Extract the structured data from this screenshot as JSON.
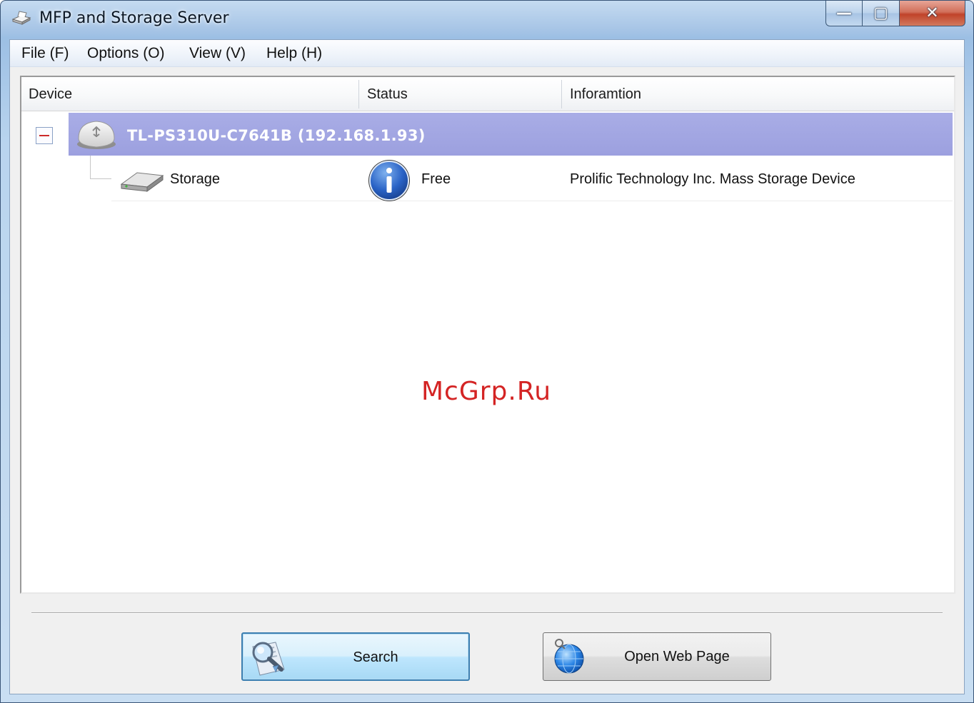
{
  "window": {
    "title": "MFP and Storage Server",
    "caption_buttons": {
      "minimize": "—",
      "maximize": "▢",
      "close": "✕"
    }
  },
  "menu": {
    "items": [
      {
        "label": "File (F)"
      },
      {
        "label": "Options (O)"
      },
      {
        "label": "View (V)"
      },
      {
        "label": "Help (H)"
      }
    ]
  },
  "list": {
    "columns": [
      "Device",
      "Status",
      "Inforamtion"
    ],
    "device": {
      "name": "TL-PS310U-C7641B  (192.168.1.93)",
      "expanded": true,
      "icon": "usb-server-icon"
    },
    "children": [
      {
        "device": "Storage",
        "device_icon": "storage-drive-icon",
        "status": "Free",
        "status_icon": "info-icon",
        "information": "Prolific Technology Inc. Mass Storage Device"
      }
    ]
  },
  "watermark": "McGrp.Ru",
  "buttons": {
    "search_label": "Search",
    "open_web_label": "Open Web Page"
  },
  "colors": {
    "selected_row": "#a9ade6",
    "watermark": "#d42424",
    "focus_border": "#3c7fb1"
  }
}
